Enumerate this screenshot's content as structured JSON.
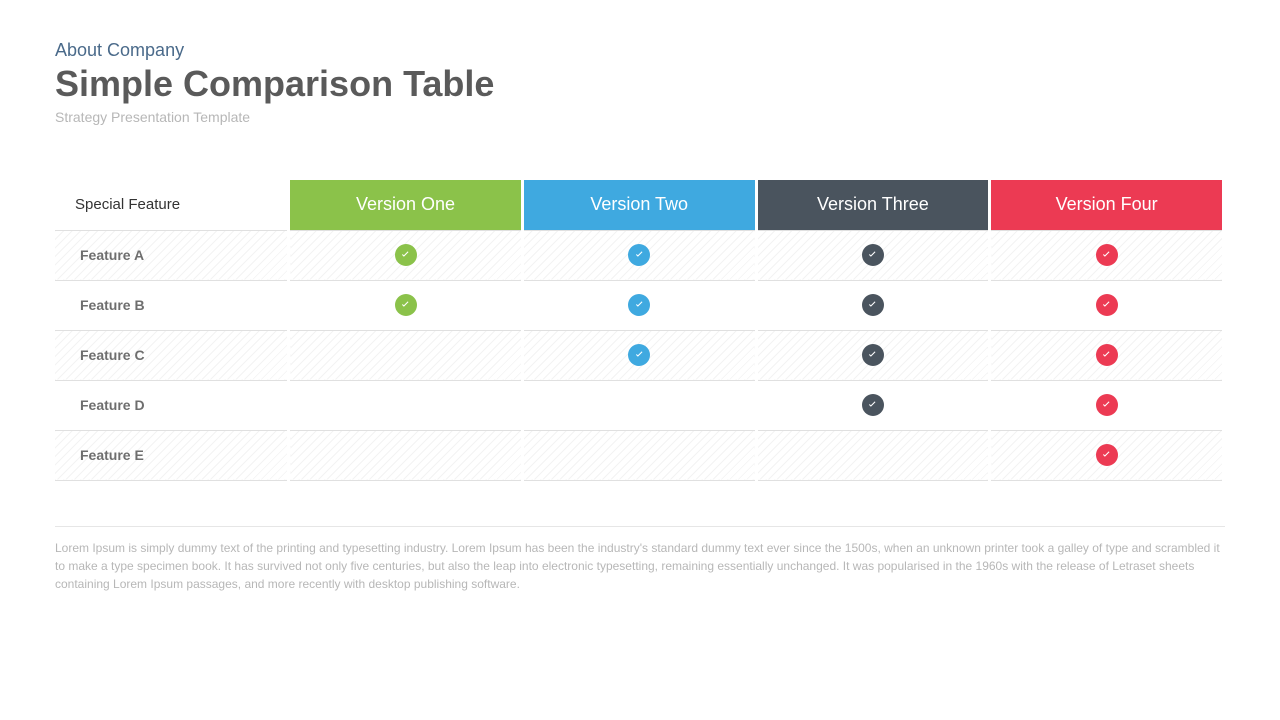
{
  "header": {
    "eyebrow": "About Company",
    "title": "Simple Comparison Table",
    "subtitle": "Strategy Presentation Template"
  },
  "table": {
    "row_header_label": "Special Feature",
    "columns": [
      "Version One",
      "Version Two",
      "Version Three",
      "Version Four"
    ],
    "column_colors": [
      "#8bc24a",
      "#3fa9e0",
      "#4a545e",
      "#ec3a53"
    ],
    "rows": [
      {
        "label": "Feature A",
        "cells": [
          true,
          true,
          true,
          true
        ]
      },
      {
        "label": "Feature B",
        "cells": [
          true,
          true,
          true,
          true
        ]
      },
      {
        "label": "Feature C",
        "cells": [
          false,
          true,
          true,
          true
        ]
      },
      {
        "label": "Feature D",
        "cells": [
          false,
          false,
          true,
          true
        ]
      },
      {
        "label": "Feature E",
        "cells": [
          false,
          false,
          false,
          true
        ]
      }
    ]
  },
  "footnote": "Lorem Ipsum is simply dummy text of the printing and typesetting industry. Lorem Ipsum has been the industry's standard dummy text ever since the 1500s, when an unknown printer took a galley of type and scrambled it to make a type specimen book. It has survived not only five centuries, but also the leap into electronic typesetting, remaining essentially unchanged. It was popularised in the 1960s with the release of Letraset sheets containing Lorem Ipsum passages, and more recently with desktop publishing software."
}
